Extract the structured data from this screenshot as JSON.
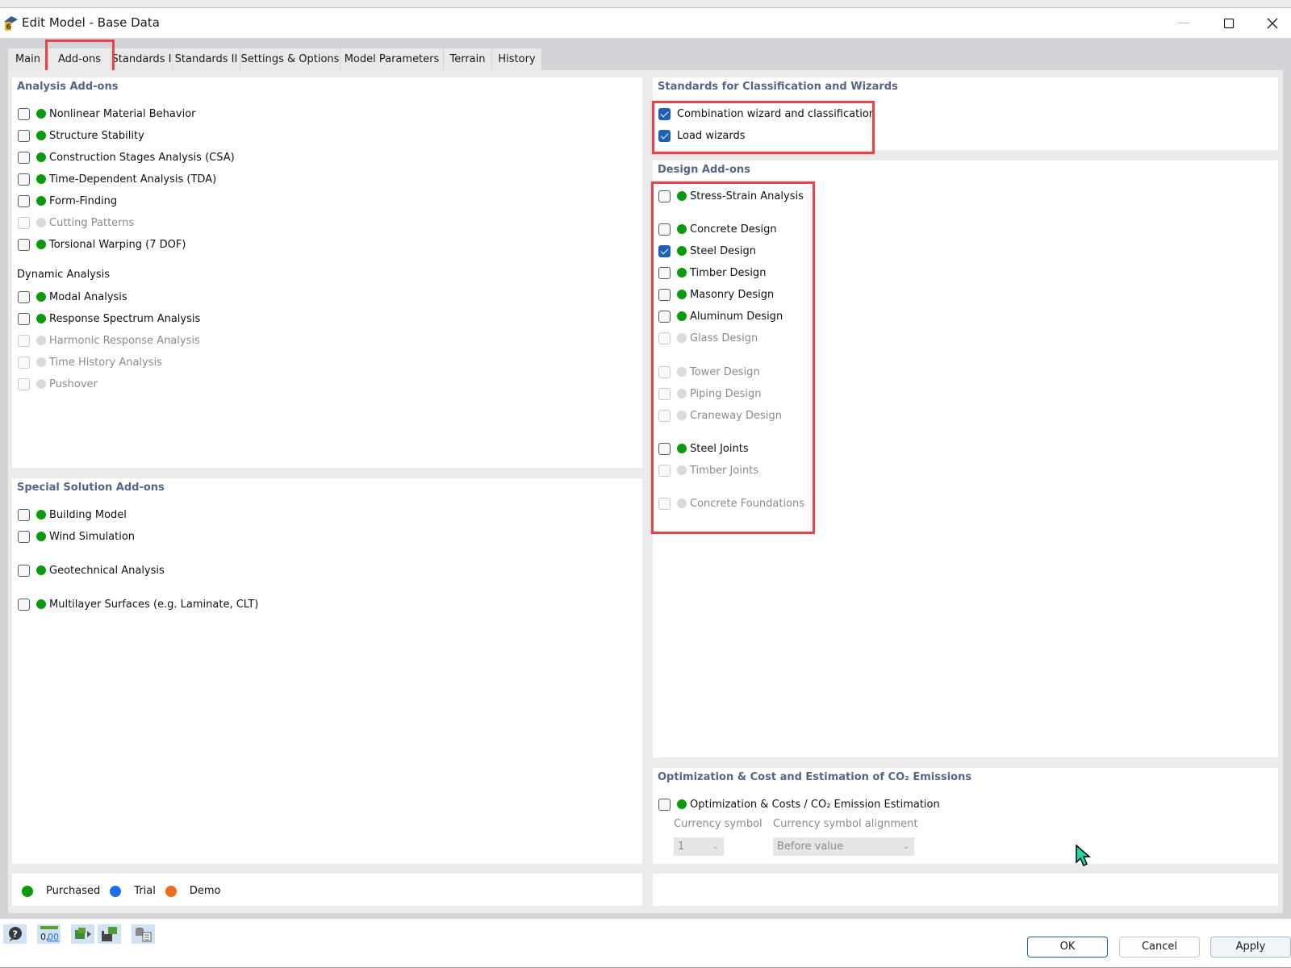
{
  "window": {
    "title": "Edit Model - Base Data",
    "icons": {
      "app": "rfem-app-icon",
      "minimize": "minimize-icon",
      "maximize": "maximize-icon",
      "close": "close-icon"
    }
  },
  "tabs": [
    {
      "label": "Main",
      "active": false
    },
    {
      "label": "Add-ons",
      "active": true
    },
    {
      "label": "Standards I",
      "active": false
    },
    {
      "label": "Standards II",
      "active": false
    },
    {
      "label": "Settings & Options",
      "active": false
    },
    {
      "label": "Model Parameters",
      "active": false
    },
    {
      "label": "Terrain",
      "active": false
    },
    {
      "label": "History",
      "active": false
    }
  ],
  "analysis_addons": {
    "title": "Analysis Add-ons",
    "items": [
      {
        "label": "Nonlinear Material Behavior",
        "checked": false,
        "status": "purchased",
        "enabled": true
      },
      {
        "label": "Structure Stability",
        "checked": false,
        "status": "purchased",
        "enabled": true
      },
      {
        "label": "Construction Stages Analysis (CSA)",
        "checked": false,
        "status": "purchased",
        "enabled": true
      },
      {
        "label": "Time-Dependent Analysis (TDA)",
        "checked": false,
        "status": "purchased",
        "enabled": true
      },
      {
        "label": "Form-Finding",
        "checked": false,
        "status": "purchased",
        "enabled": true
      },
      {
        "label": "Cutting Patterns",
        "checked": false,
        "status": "unavailable",
        "enabled": false
      },
      {
        "label": "Torsional Warping (7 DOF)",
        "checked": false,
        "status": "purchased",
        "enabled": true
      }
    ],
    "dynamic_title": "Dynamic Analysis",
    "dynamic_items": [
      {
        "label": "Modal Analysis",
        "checked": false,
        "status": "purchased",
        "enabled": true
      },
      {
        "label": "Response Spectrum Analysis",
        "checked": false,
        "status": "purchased",
        "enabled": true
      },
      {
        "label": "Harmonic Response Analysis",
        "checked": false,
        "status": "unavailable",
        "enabled": false
      },
      {
        "label": "Time History Analysis",
        "checked": false,
        "status": "unavailable",
        "enabled": false
      },
      {
        "label": "Pushover",
        "checked": false,
        "status": "unavailable",
        "enabled": false
      }
    ]
  },
  "special_addons": {
    "title": "Special Solution Add-ons",
    "items": [
      {
        "label": "Building Model",
        "checked": false,
        "status": "purchased",
        "enabled": true
      },
      {
        "label": "Wind Simulation",
        "checked": false,
        "status": "purchased",
        "enabled": true
      },
      {
        "label": "Geotechnical Analysis",
        "checked": false,
        "status": "purchased",
        "enabled": true
      },
      {
        "label": "Multilayer Surfaces (e.g. Laminate, CLT)",
        "checked": false,
        "status": "purchased",
        "enabled": true
      }
    ]
  },
  "standards_wizards": {
    "title": "Standards for Classification and Wizards",
    "items": [
      {
        "label": "Combination wizard and classification",
        "checked": true
      },
      {
        "label": "Load wizards",
        "checked": true
      }
    ]
  },
  "design_addons": {
    "title": "Design Add-ons",
    "items": [
      {
        "label": "Stress-Strain Analysis",
        "checked": false,
        "status": "purchased",
        "enabled": true
      },
      {
        "label": "Concrete Design",
        "checked": false,
        "status": "purchased",
        "enabled": true
      },
      {
        "label": "Steel Design",
        "checked": true,
        "status": "purchased",
        "enabled": true
      },
      {
        "label": "Timber Design",
        "checked": false,
        "status": "purchased",
        "enabled": true
      },
      {
        "label": "Masonry Design",
        "checked": false,
        "status": "purchased",
        "enabled": true
      },
      {
        "label": "Aluminum Design",
        "checked": false,
        "status": "purchased",
        "enabled": true
      },
      {
        "label": "Glass Design",
        "checked": false,
        "status": "unavailable",
        "enabled": false
      },
      {
        "label": "Tower Design",
        "checked": false,
        "status": "unavailable",
        "enabled": false
      },
      {
        "label": "Piping Design",
        "checked": false,
        "status": "unavailable",
        "enabled": false
      },
      {
        "label": "Craneway Design",
        "checked": false,
        "status": "unavailable",
        "enabled": false
      },
      {
        "label": "Steel Joints",
        "checked": false,
        "status": "purchased",
        "enabled": true
      },
      {
        "label": "Timber Joints",
        "checked": false,
        "status": "unavailable",
        "enabled": false
      },
      {
        "label": "Concrete Foundations",
        "checked": false,
        "status": "unavailable",
        "enabled": false
      }
    ]
  },
  "optimization": {
    "title": "Optimization & Cost and Estimation of CO₂ Emissions",
    "item": {
      "label": "Optimization & Costs / CO₂ Emission Estimation",
      "checked": false,
      "status": "purchased",
      "enabled": true
    },
    "currency_symbol_label": "Currency symbol",
    "currency_symbol_value": "1",
    "alignment_label": "Currency symbol alignment",
    "alignment_value": "Before value"
  },
  "legend": [
    {
      "label": "Purchased",
      "color": "#0a9a0a"
    },
    {
      "label": "Trial",
      "color": "#1a6ff0"
    },
    {
      "label": "Demo",
      "color": "#f26b1d"
    }
  ],
  "toolbar": {
    "icons": [
      "help-icon",
      "units-decimal-icon",
      "export-model-icon",
      "save-model-icon",
      "database-document-icon"
    ],
    "units_text": "0,00"
  },
  "buttons": {
    "ok": "OK",
    "cancel": "Cancel",
    "apply": "Apply"
  },
  "colors": {
    "purchased": "#0a9a0a",
    "unavailable": "#d9d9de",
    "section_title": "#566585",
    "checkbox_checked": "#1f5fb5",
    "highlight": "#e8424a"
  }
}
